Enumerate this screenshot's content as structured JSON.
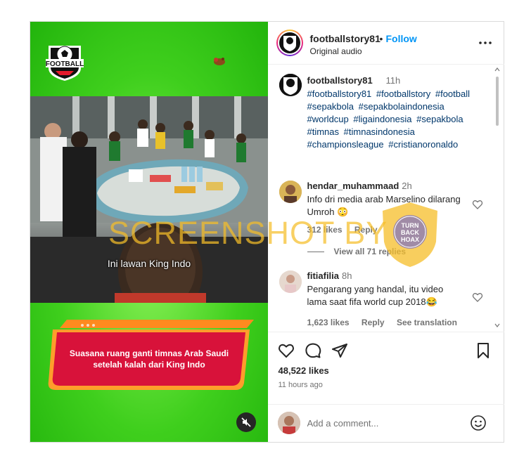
{
  "post": {
    "media": {
      "logo_text": "FOOTBALL",
      "subtitle": "Ini lawan King Indo",
      "banner_text": "Suasana ruang ganti timnas Arab Saudi setelah kalah dari King Indo",
      "mute_icon": "speaker-muted-icon"
    },
    "header": {
      "username": "footballstory81",
      "separator": "•",
      "follow_label": "Follow",
      "audio_label": "Original audio",
      "more_icon": "more-icon"
    },
    "caption": {
      "username": "footballstory81",
      "time": "11h",
      "hashtags": [
        "#footballstory81",
        "#footballstory",
        "#football",
        "#sepakbola",
        "#sepakbolaindonesia",
        "#worldcup",
        "#ligaindonesia",
        "#sepakbola",
        "#timnas",
        "#timnasindonesia",
        "#championsleague",
        "#cristianoronaldo"
      ]
    },
    "comments": [
      {
        "username": "hendar_muhammaad",
        "time": "2h",
        "text": "Info dri media arab Marselino dilarang Umroh 😳",
        "likes": "312 likes",
        "reply_label": "Reply",
        "view_replies": "View all 71 replies"
      },
      {
        "username": "fitiafilia",
        "time": "8h",
        "text": "Pengarang yang handal, itu video lama saat fifa world cup 2018😂",
        "likes": "1,623 likes",
        "reply_label": "Reply",
        "translation_label": "See translation"
      }
    ],
    "actions": {
      "likes_count": "48,522 likes",
      "posted_ago": "11 hours ago"
    },
    "add_comment": {
      "placeholder": "Add a comment..."
    }
  },
  "watermark": {
    "text": "SCREENSHOT BY",
    "badge_center": "TURN BACK HOAX",
    "badge_ring_top": "MASYARAKAT ANTI FITNAH INDONESIA",
    "badge_ring_bottom": "MAFINDO"
  },
  "colors": {
    "follow_blue": "#0095f6",
    "hashtag_blue": "#00376b",
    "banner_red": "#d8123a",
    "banner_orange": "#ff8a1f",
    "watermark_yellow": "#f5be28",
    "badge_purple": "#8a7bb8"
  }
}
